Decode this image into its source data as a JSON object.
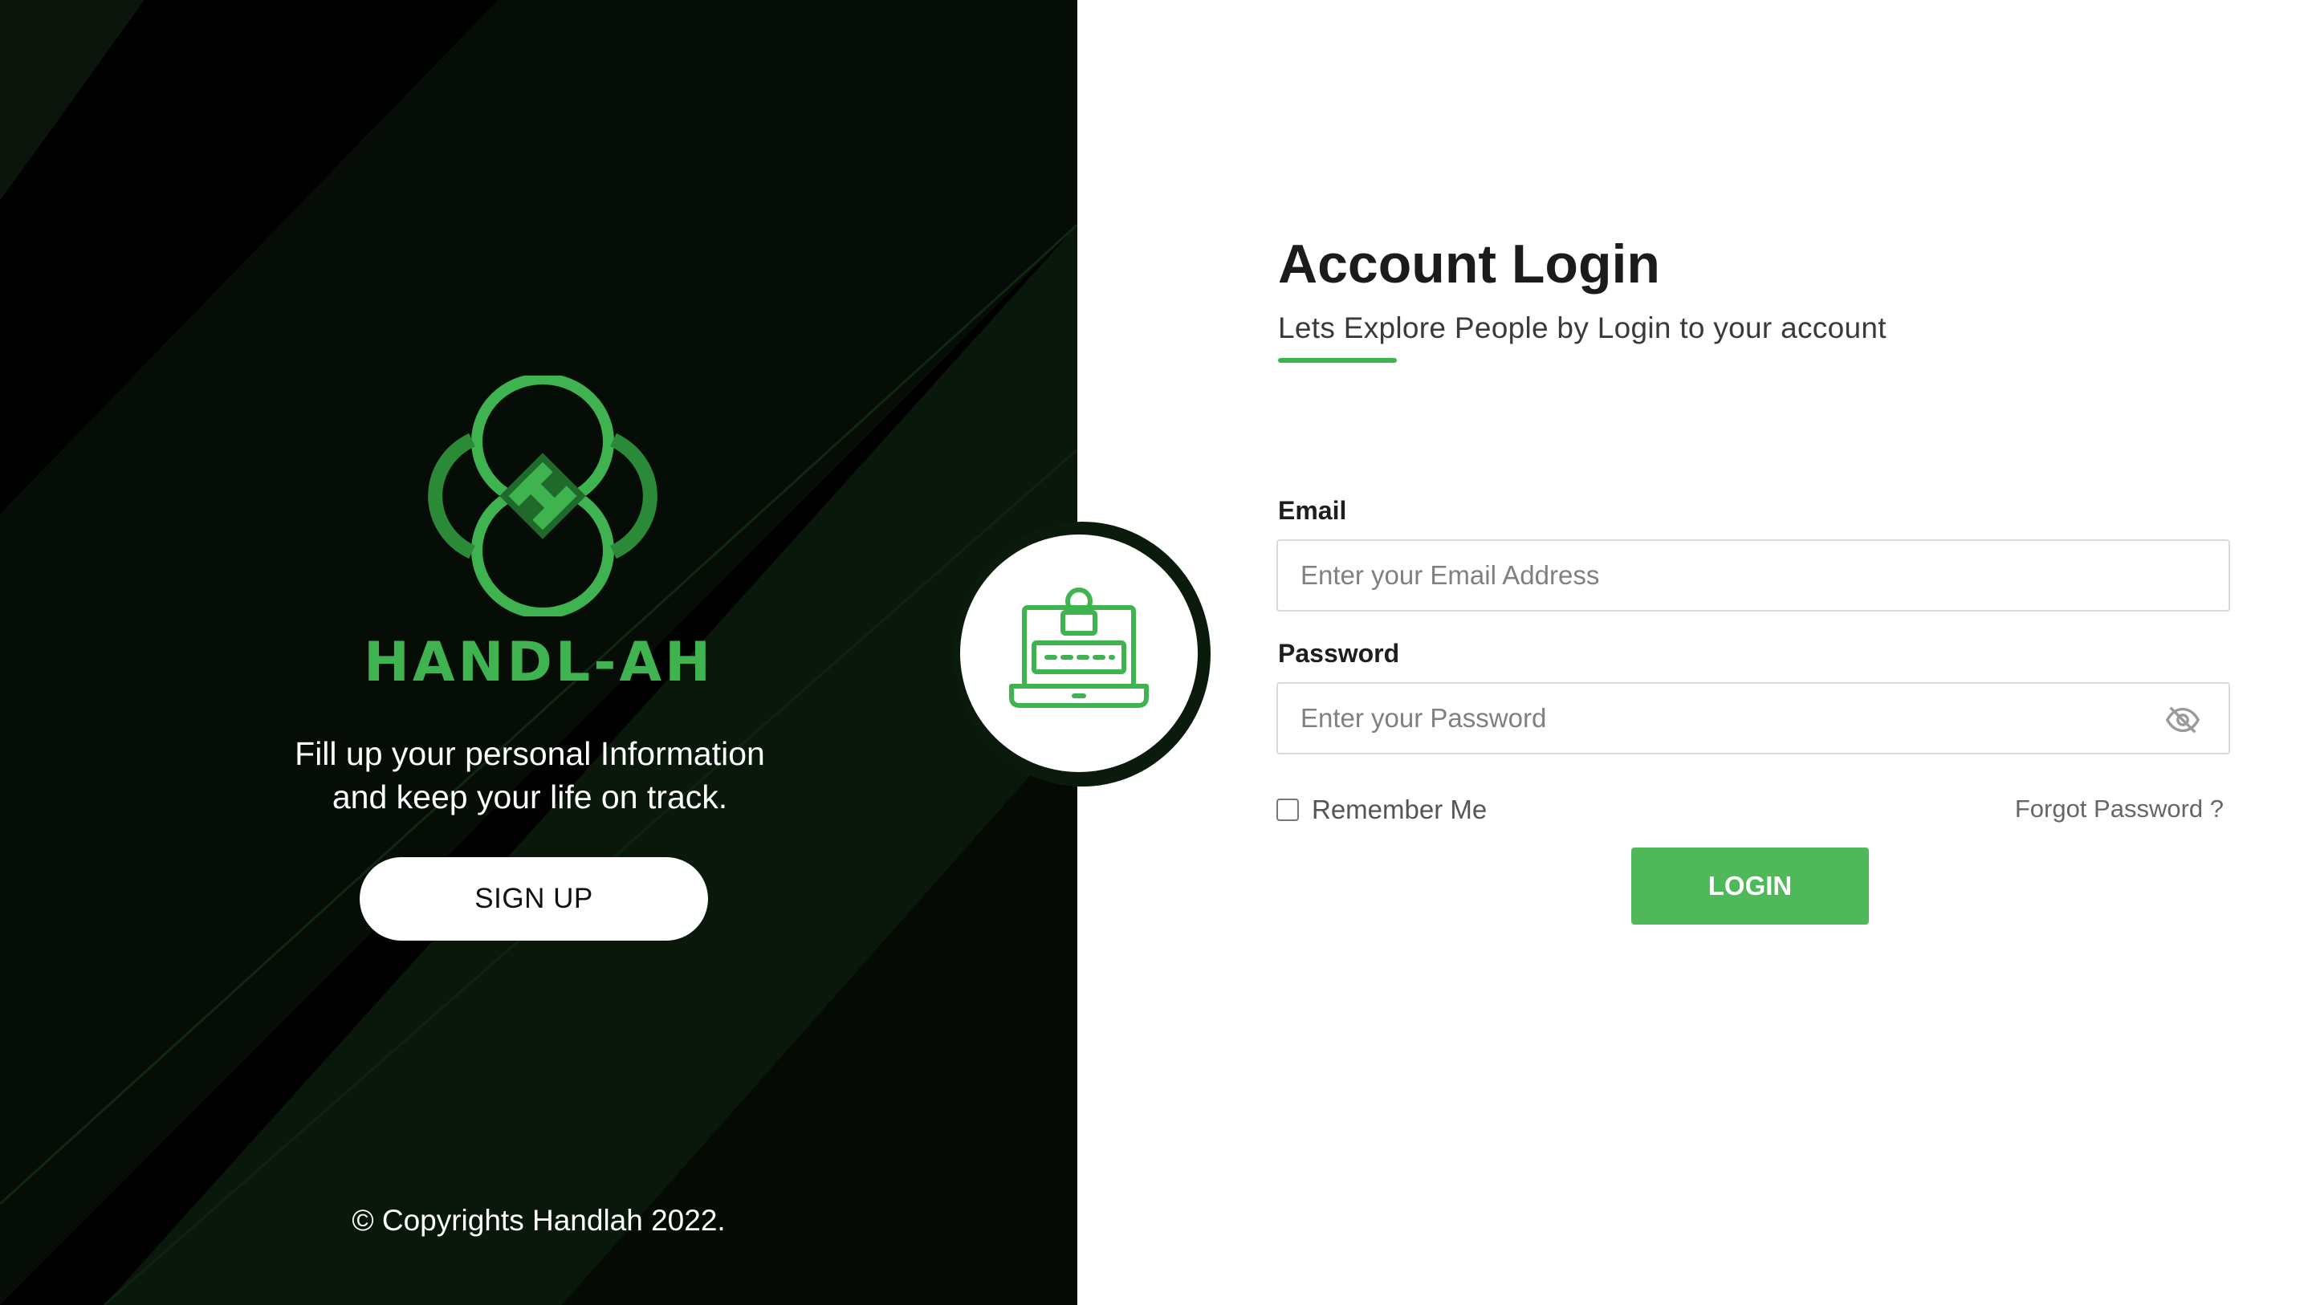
{
  "brand": {
    "name": "HANDL-AH",
    "tagline_line1": "Fill up your personal Information",
    "tagline_line2": "and keep your life on track.",
    "signup_label": "SIGN UP",
    "copyright": "© Copyrights Handlah 2022.",
    "accent_color": "#3fb34f"
  },
  "login": {
    "title": "Account Login",
    "subtitle": "Lets Explore People by Login to your account",
    "email_label": "Email",
    "email_placeholder": "Enter your Email Address",
    "password_label": "Password",
    "password_placeholder": "Enter your Password",
    "remember_label": "Remember Me",
    "remember_checked": false,
    "forgot_label": "Forgot Password ?",
    "login_label": "LOGIN",
    "button_color": "#4fb859"
  },
  "icons": {
    "badge": "laptop-login-icon",
    "password_toggle": "eye-off-icon",
    "logo": "handlah-logo-icon"
  }
}
